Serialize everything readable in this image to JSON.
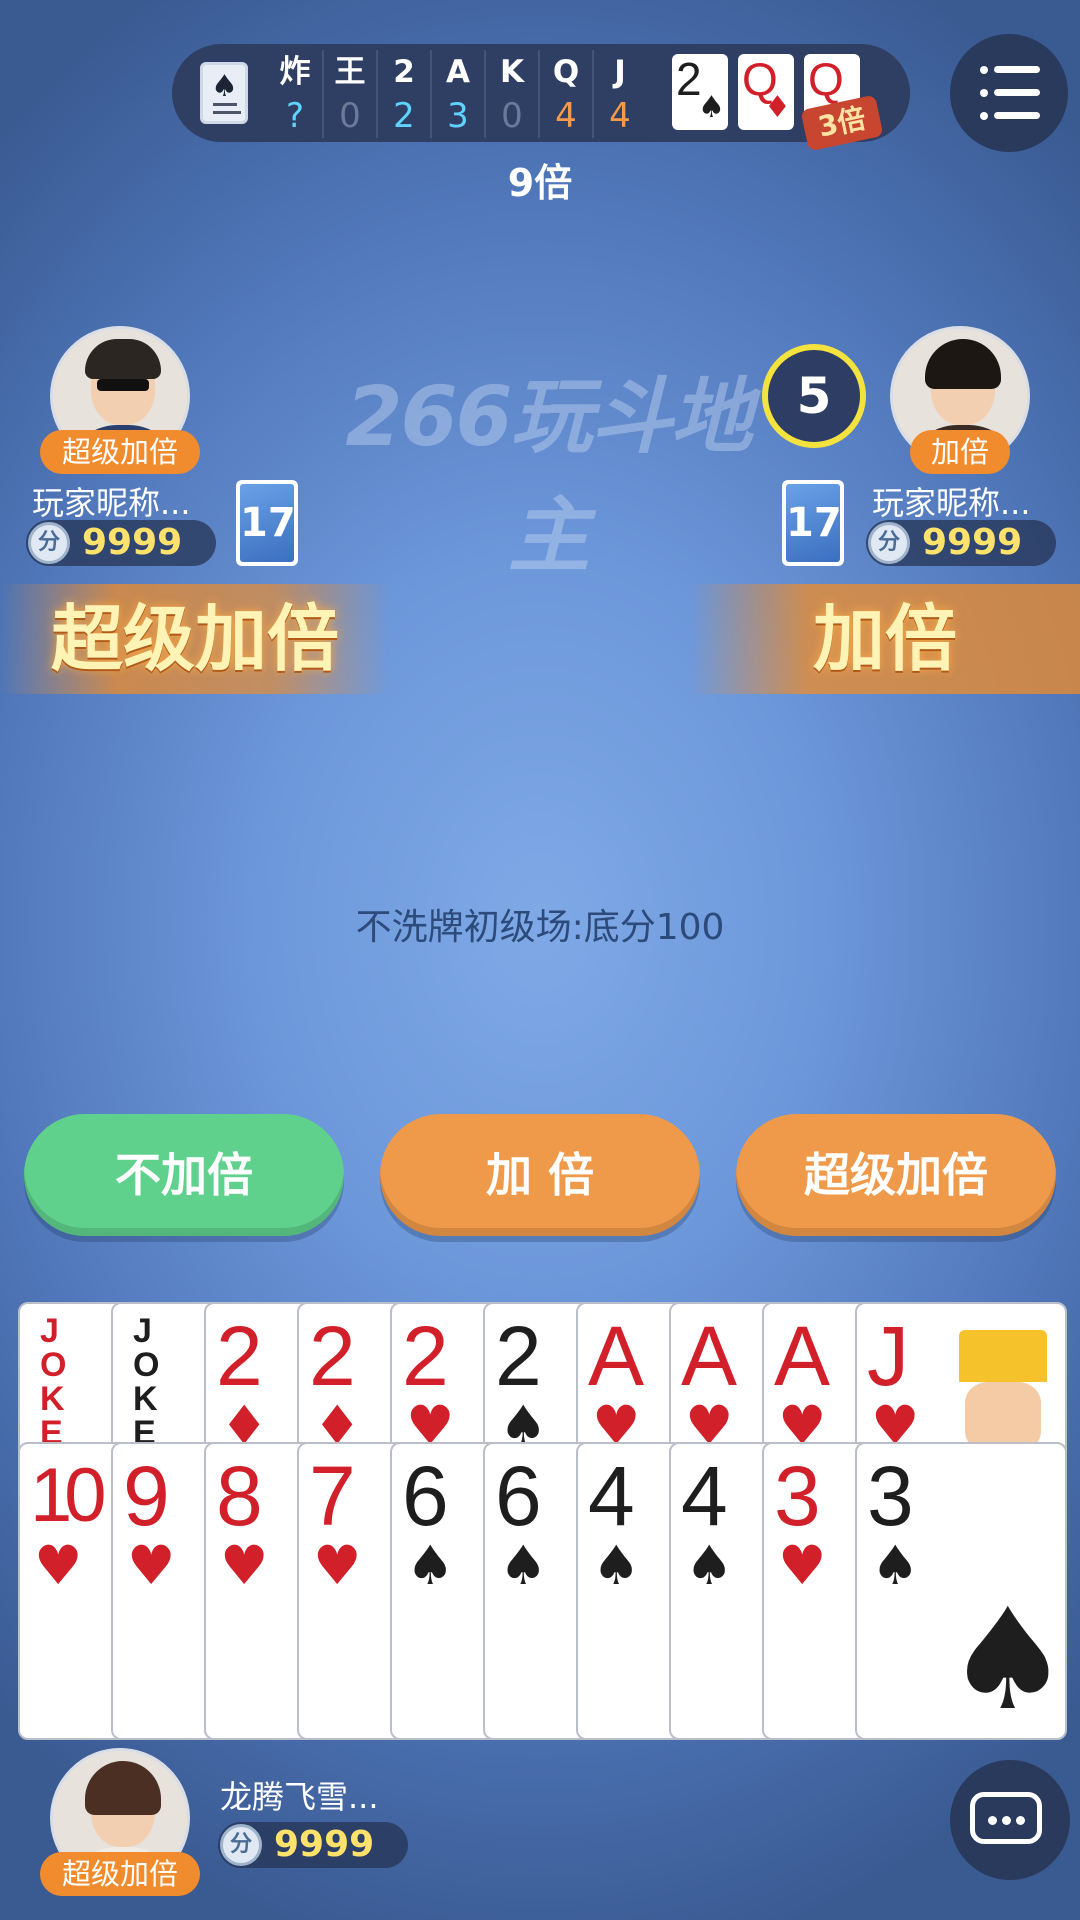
{
  "counter": {
    "columns": [
      {
        "rank": "炸",
        "count": "?",
        "color": "#5fd3ff"
      },
      {
        "rank": "王",
        "count": "0",
        "color": "#6b7a99"
      },
      {
        "rank": "2",
        "count": "2",
        "color": "#5fd3ff"
      },
      {
        "rank": "A",
        "count": "3",
        "color": "#5fd3ff"
      },
      {
        "rank": "K",
        "count": "0",
        "color": "#6b7a99"
      },
      {
        "rank": "Q",
        "count": "4",
        "color": "#f59a4a"
      },
      {
        "rank": "J",
        "count": "4",
        "color": "#f59a4a"
      }
    ],
    "bottom_cards": [
      {
        "rank": "2",
        "suit": "♠",
        "color": "black"
      },
      {
        "rank": "Q",
        "suit": "♦",
        "color": "red"
      },
      {
        "rank": "Q",
        "suit": "",
        "color": "red"
      }
    ],
    "bottom_badge": "3倍"
  },
  "multiplier": "9倍",
  "watermark": "266玩斗地主",
  "timer": "5",
  "left_player": {
    "name": "玩家昵称...",
    "score": "9999",
    "role": "超级加倍",
    "cards_left": "17",
    "action": "超级加倍"
  },
  "right_player": {
    "name": "玩家昵称...",
    "score": "9999",
    "role": "加倍",
    "cards_left": "17",
    "action": "加倍"
  },
  "coin_label": "分",
  "room_info": "不洗牌初级场:底分100",
  "buttons": {
    "no_double": "不加倍",
    "double": "加 倍",
    "super_double": "超级加倍"
  },
  "hand_top": [
    {
      "rank": "JOKER",
      "suit": "",
      "color": "red",
      "joker": true
    },
    {
      "rank": "JOKER",
      "suit": "",
      "color": "black",
      "joker": true
    },
    {
      "rank": "2",
      "suit": "♦",
      "color": "red"
    },
    {
      "rank": "2",
      "suit": "♦",
      "color": "red"
    },
    {
      "rank": "2",
      "suit": "♥",
      "color": "red"
    },
    {
      "rank": "2",
      "suit": "♠",
      "color": "black"
    },
    {
      "rank": "A",
      "suit": "♥",
      "color": "red"
    },
    {
      "rank": "A",
      "suit": "♥",
      "color": "red"
    },
    {
      "rank": "A",
      "suit": "♥",
      "color": "red"
    },
    {
      "rank": "J",
      "suit": "♥",
      "color": "red",
      "face": true
    }
  ],
  "hand_bottom": [
    {
      "rank": "10",
      "suit": "♥",
      "color": "red"
    },
    {
      "rank": "9",
      "suit": "♥",
      "color": "red"
    },
    {
      "rank": "8",
      "suit": "♥",
      "color": "red"
    },
    {
      "rank": "7",
      "suit": "♥",
      "color": "red"
    },
    {
      "rank": "6",
      "suit": "♠",
      "color": "black"
    },
    {
      "rank": "6",
      "suit": "♠",
      "color": "black"
    },
    {
      "rank": "4",
      "suit": "♠",
      "color": "black"
    },
    {
      "rank": "4",
      "suit": "♠",
      "color": "black"
    },
    {
      "rank": "3",
      "suit": "♥",
      "color": "red"
    },
    {
      "rank": "3",
      "suit": "♠",
      "color": "black",
      "big": true
    }
  ],
  "self_player": {
    "name": "龙腾飞雪...",
    "score": "9999",
    "role": "超级加倍"
  }
}
